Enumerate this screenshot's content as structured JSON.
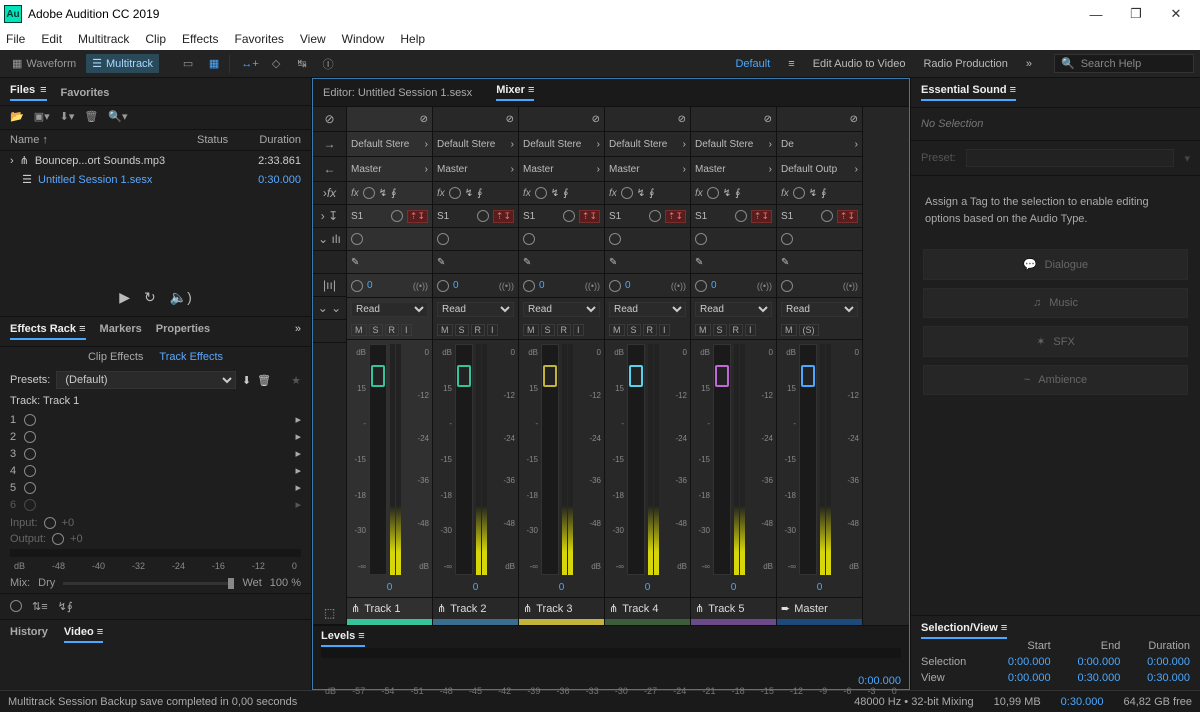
{
  "app": {
    "title": "Adobe Audition CC 2019",
    "logo": "Au"
  },
  "menu": [
    "File",
    "Edit",
    "Multitrack",
    "Clip",
    "Effects",
    "Favorites",
    "View",
    "Window",
    "Help"
  ],
  "modes": {
    "waveform": "Waveform",
    "multitrack": "Multitrack"
  },
  "workspaces": {
    "default": "Default",
    "editav": "Edit Audio to Video",
    "radio": "Radio Production"
  },
  "search_placeholder": "Search Help",
  "files_panel": {
    "tabs": {
      "files": "Files",
      "favorites": "Favorites"
    },
    "cols": {
      "name": "Name ↑",
      "status": "Status",
      "duration": "Duration"
    },
    "rows": [
      {
        "icon": "audio",
        "name": "Bouncep...ort Sounds.mp3",
        "status": "",
        "dur": "2:33.861",
        "active": false
      },
      {
        "icon": "session",
        "name": "Untitled Session 1.sesx",
        "status": "",
        "dur": "0:30.000",
        "active": true
      }
    ]
  },
  "effects_rack": {
    "tabs": [
      "Effects Rack",
      "Markers",
      "Properties"
    ],
    "subtabs": [
      "Clip Effects",
      "Track Effects"
    ],
    "presets_label": "Presets:",
    "preset_value": "(Default)",
    "track_label": "Track: Track 1",
    "slots": [
      "1",
      "2",
      "3",
      "4",
      "5",
      "6"
    ],
    "input_label": "Input:",
    "input_val": "+0",
    "output_label": "Output:",
    "output_val": "+0",
    "ruler": [
      "dB",
      "-48",
      "-40",
      "-32",
      "-24",
      "-16",
      "-12",
      "0"
    ],
    "mix": {
      "label": "Mix:",
      "dry": "Dry",
      "wet": "Wet",
      "pct": "100 %"
    }
  },
  "bottom_tabs": {
    "history": "History",
    "video": "Video"
  },
  "editor": {
    "session_label": "Editor: Untitled Session 1.sesx",
    "mixer_label": "Mixer",
    "timecode": "0:00.000",
    "row_icons": [
      "→",
      "←",
      "fx",
      "↓S1",
      "ılı",
      "|ıı|",
      "⌄"
    ],
    "channels": [
      {
        "name": "Track 1",
        "color": "#36c29a",
        "knob": "#36c29a",
        "in": "Default Stere",
        "out": "Master",
        "send": "S1",
        "pan": "0",
        "read": "Read",
        "val": "0"
      },
      {
        "name": "Track 2",
        "color": "#3a6e8f",
        "knob": "#36c29a",
        "in": "Default Stere",
        "out": "Master",
        "send": "S1",
        "pan": "0",
        "read": "Read",
        "val": "0"
      },
      {
        "name": "Track 3",
        "color": "#c2b33a",
        "knob": "#c2b33a",
        "in": "Default Stere",
        "out": "Master",
        "send": "S1",
        "pan": "0",
        "read": "Read",
        "val": "0"
      },
      {
        "name": "Track 4",
        "color": "#3a5e3a",
        "knob": "#56d2ec",
        "in": "Default Stere",
        "out": "Master",
        "send": "S1",
        "pan": "0",
        "read": "Read",
        "val": "0"
      },
      {
        "name": "Track 5",
        "color": "#6b4a8a",
        "knob": "#c267d6",
        "in": "Default Stere",
        "out": "Master",
        "send": "S1",
        "pan": "0",
        "read": "Read",
        "val": "0"
      },
      {
        "name": "Master",
        "color": "#1d4a7a",
        "knob": "#4aa8ff",
        "in": "De",
        "out": "Default Outp",
        "send": "S1",
        "pan": "",
        "read": "Read",
        "val": "0",
        "master": true
      }
    ],
    "fader_scale_left": [
      "dB",
      "15",
      "-",
      "-15",
      "-18",
      "-30",
      "-∞"
    ],
    "fader_scale_right": [
      "0",
      "-12",
      "-24",
      "-36",
      "-48",
      "dB"
    ],
    "msr": [
      "M",
      "S",
      "R",
      "I"
    ],
    "msr_master": [
      "M",
      "(S)"
    ],
    "levels_label": "Levels",
    "levels_ruler": [
      "dB",
      "-57",
      "-54",
      "-51",
      "-48",
      "-45",
      "-42",
      "-39",
      "-36",
      "-33",
      "-30",
      "-27",
      "-24",
      "-21",
      "-18",
      "-15",
      "-12",
      "-9",
      "-6",
      "-3",
      "0"
    ]
  },
  "essential": {
    "title": "Essential Sound",
    "no_selection": "No Selection",
    "preset_label": "Preset:",
    "msg": "Assign a Tag to the selection to enable editing options based on the Audio Type.",
    "btns": [
      {
        "icon": "💬",
        "label": "Dialogue"
      },
      {
        "icon": "♫",
        "label": "Music"
      },
      {
        "icon": "✶",
        "label": "SFX"
      },
      {
        "icon": "~",
        "label": "Ambience"
      }
    ]
  },
  "selview": {
    "title": "Selection/View",
    "heads": [
      "",
      "Start",
      "End",
      "Duration"
    ],
    "rows": [
      {
        "l": "Selection",
        "s": "0:00.000",
        "e": "0:00.000",
        "d": "0:00.000"
      },
      {
        "l": "View",
        "s": "0:00.000",
        "e": "0:30.000",
        "d": "0:30.000"
      }
    ]
  },
  "status": {
    "msg": "Multitrack Session Backup save completed in 0,00 seconds",
    "sample": "48000 Hz • 32-bit Mixing",
    "mem": "10,99 MB",
    "dur": "0:30.000",
    "free": "64,82 GB free"
  }
}
